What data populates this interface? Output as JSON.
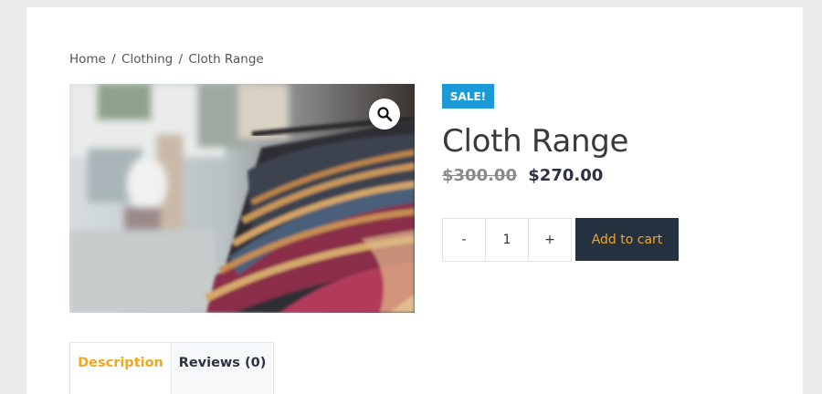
{
  "breadcrumb": {
    "home": "Home",
    "category": "Clothing",
    "current": "Cloth Range",
    "separator": "/"
  },
  "product": {
    "badge": "SALE!",
    "title": "Cloth Range",
    "old_price": "$300.00",
    "new_price": "$270.00",
    "image_icon": "magnifier-icon"
  },
  "cart": {
    "minus_label": "-",
    "quantity": "1",
    "plus_label": "+",
    "add_label": "Add to cart"
  },
  "tabs": [
    {
      "label": "Description",
      "active": true
    },
    {
      "label": "Reviews (0)",
      "active": false
    }
  ],
  "colors": {
    "sale_badge": "#1a9bd7",
    "accent": "#f2a71e",
    "button_bg": "#263140",
    "page_bg": "#ebebeb"
  }
}
